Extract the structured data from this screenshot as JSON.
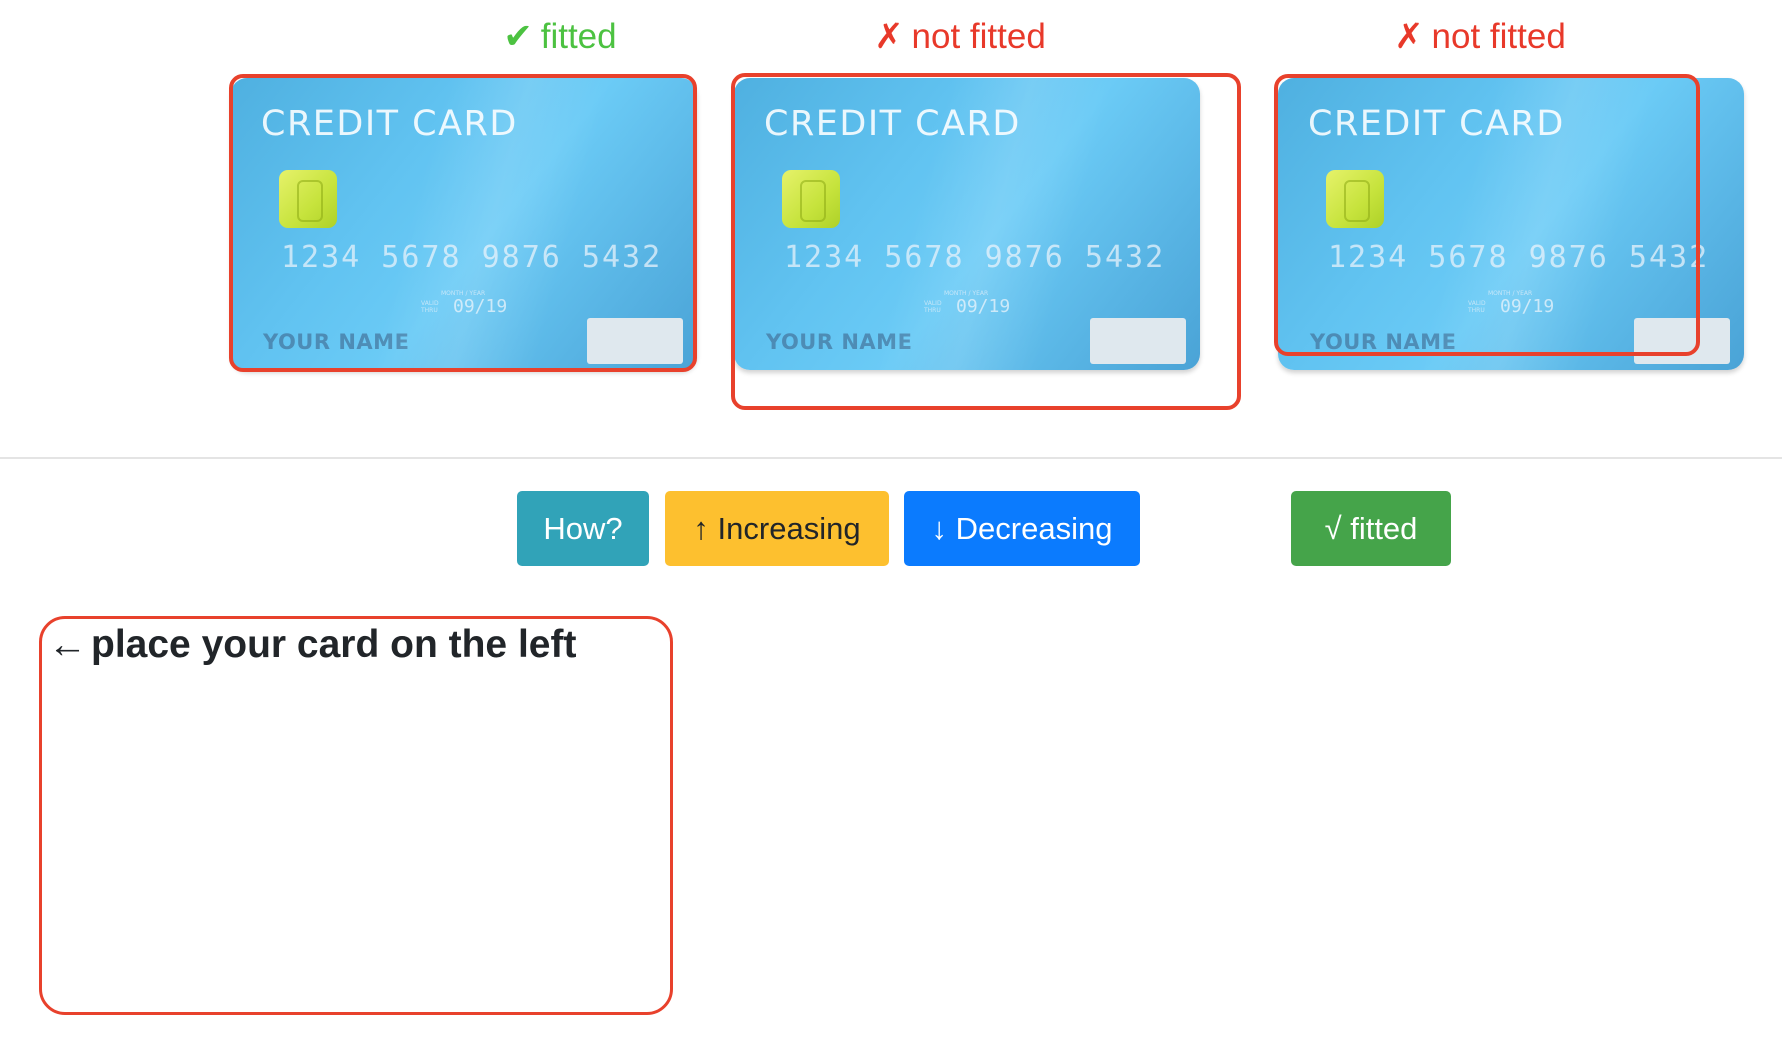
{
  "examples": [
    {
      "status_mark": "✔",
      "status_text": "fitted",
      "status_color": "#4cc241",
      "card": {
        "title": "CREDIT CARD",
        "number": "1234 5678 9876 5432",
        "expiry_header": "MONTH / YEAR",
        "valid_label": "VALID THRU",
        "expiry": "09/19",
        "name": "YOUR NAME"
      }
    },
    {
      "status_mark": "✗",
      "status_text": "not fitted",
      "status_color": "#e8392a",
      "card": {
        "title": "CREDIT CARD",
        "number": "1234 5678 9876 5432",
        "expiry_header": "MONTH / YEAR",
        "valid_label": "VALID THRU",
        "expiry": "09/19",
        "name": "YOUR NAME"
      }
    },
    {
      "status_mark": "✗",
      "status_text": "not fitted",
      "status_color": "#e8392a",
      "card": {
        "title": "CREDIT CARD",
        "number": "1234 5678 9876 5432",
        "expiry_header": "MONTH / YEAR",
        "valid_label": "VALID THRU",
        "expiry": "09/19",
        "name": "YOUR NAME"
      }
    }
  ],
  "toolbar": {
    "how_label": "How?",
    "increasing_label": "↑ Increasing",
    "decreasing_label": "↓ Decreasing",
    "fitted_label": "√ fitted"
  },
  "drop_zone": {
    "arrow": "←",
    "hint": "place your card on the left"
  },
  "colors": {
    "frame_red": "#e8412c",
    "info": "#31a3b8",
    "warning": "#fdc02f",
    "primary": "#0b7bfe",
    "success": "#45a44a"
  }
}
